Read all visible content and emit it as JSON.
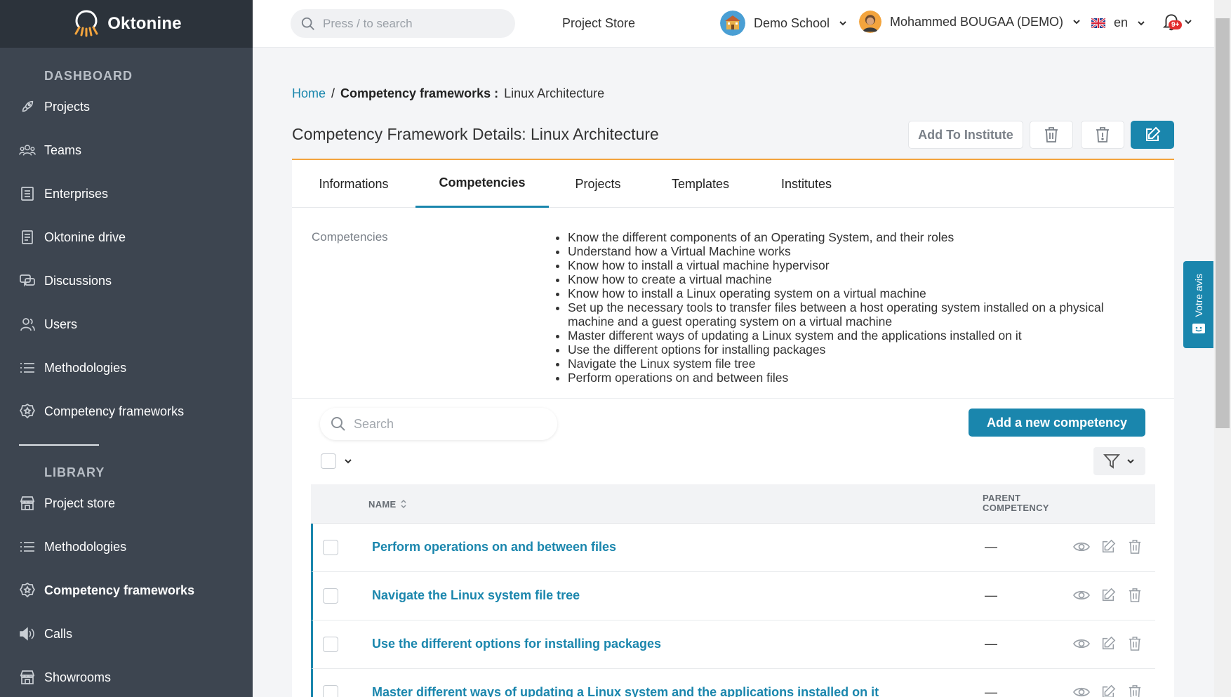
{
  "app": {
    "name": "Oktonine"
  },
  "sidebar": {
    "sections": [
      {
        "title": "DASHBOARD",
        "items": [
          {
            "label": "Projects",
            "icon": "rocket-icon"
          },
          {
            "label": "Teams",
            "icon": "team-icon"
          },
          {
            "label": "Enterprises",
            "icon": "building-icon"
          },
          {
            "label": "Oktonine drive",
            "icon": "drive-icon"
          },
          {
            "label": "Discussions",
            "icon": "chat-icon"
          },
          {
            "label": "Users",
            "icon": "users-icon"
          },
          {
            "label": "Methodologies",
            "icon": "list-icon"
          },
          {
            "label": "Competency frameworks",
            "icon": "badge-icon"
          }
        ]
      },
      {
        "title": "LIBRARY",
        "items": [
          {
            "label": "Project store",
            "icon": "store-icon"
          },
          {
            "label": "Methodologies",
            "icon": "list-icon"
          },
          {
            "label": "Competency frameworks",
            "icon": "badge-icon",
            "active": true
          },
          {
            "label": "Calls",
            "icon": "speaker-icon"
          },
          {
            "label": "Showrooms",
            "icon": "store-icon"
          }
        ]
      }
    ]
  },
  "topbar": {
    "search_placeholder": "Press / to search",
    "project_store": "Project Store",
    "org": "Demo School",
    "user": "Mohammed BOUGAA (DEMO)",
    "lang": "en",
    "notif_badge": "9+"
  },
  "breadcrumb": {
    "home": "Home",
    "sep": "/",
    "section": "Competency frameworks :",
    "current": "Linux Architecture"
  },
  "page": {
    "title": "Competency Framework Details: Linux Architecture"
  },
  "actions": {
    "add_to_institute": "Add To Institute"
  },
  "tabs": [
    {
      "label": "Informations"
    },
    {
      "label": "Competencies",
      "active": true
    },
    {
      "label": "Projects"
    },
    {
      "label": "Templates"
    },
    {
      "label": "Institutes"
    }
  ],
  "competencies_summary": {
    "label": "Competencies",
    "items": [
      "Know the different components of an Operating System, and their roles",
      "Understand how a Virtual Machine works",
      "Know how to install a virtual machine hypervisor",
      "Know how to create a virtual machine",
      "Know how to install a Linux operating system on a virtual machine",
      "Set up the necessary tools to transfer files between a host operating system installed on a physical machine and a guest operating system on a virtual machine",
      "Master different ways of updating a Linux system and the applications installed on it",
      "Use the different options for installing packages",
      "Navigate the Linux system file tree",
      "Perform operations on and between files"
    ]
  },
  "list": {
    "search_placeholder": "Search",
    "add_button": "Add a new competency",
    "columns": {
      "name": "NAME",
      "parent": "PARENT COMPETENCY"
    },
    "rows": [
      {
        "name": "Perform operations on and between files",
        "parent": "—"
      },
      {
        "name": "Navigate the Linux system file tree",
        "parent": "—"
      },
      {
        "name": "Use the different options for installing packages",
        "parent": "—"
      },
      {
        "name": "Master different ways of updating a Linux system and the applications installed on it",
        "parent": "—"
      }
    ]
  },
  "feedback": {
    "label": "Votre avis"
  },
  "colors": {
    "accent": "#1a86ad",
    "sidebar": "#3d4550",
    "sidebar_header": "#2c333b",
    "tab_border": "#f3a43d",
    "badge": "#e32e2e"
  }
}
